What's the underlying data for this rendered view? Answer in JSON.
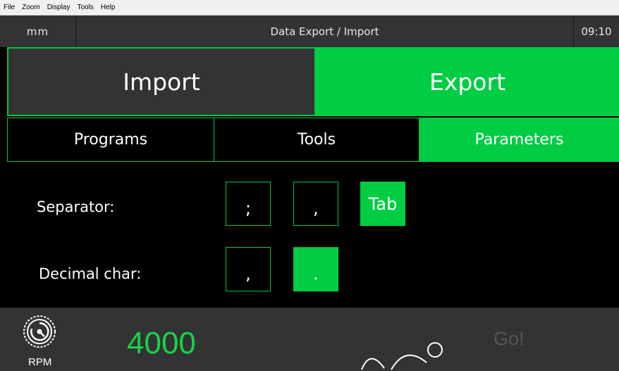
{
  "menu": [
    "File",
    "Zoom",
    "Display",
    "Tools",
    "Help"
  ],
  "header": {
    "unit": "mm",
    "title": "Data Export / Import",
    "time": "09:10"
  },
  "mode_tabs": {
    "import": "Import",
    "export": "Export",
    "selected": "Export"
  },
  "category_tabs": {
    "programs": "Programs",
    "tools": "Tools",
    "parameters": "Parameters",
    "selected": "Parameters"
  },
  "separator": {
    "label": "Separator:",
    "options": [
      ";",
      ",",
      "Tab"
    ],
    "selected": "Tab"
  },
  "decimal": {
    "label": "Decimal char:",
    "options": [
      ",",
      "."
    ],
    "selected": "."
  },
  "footer": {
    "rpm_label": "RPM",
    "rpm_value": "4000",
    "go_label": "Go!",
    "rpm_icon": "spindle-speed-icon"
  },
  "colors": {
    "accent": "#00cc44",
    "panel": "#333333",
    "background": "#000000",
    "rpm_value": "#19d24a"
  }
}
